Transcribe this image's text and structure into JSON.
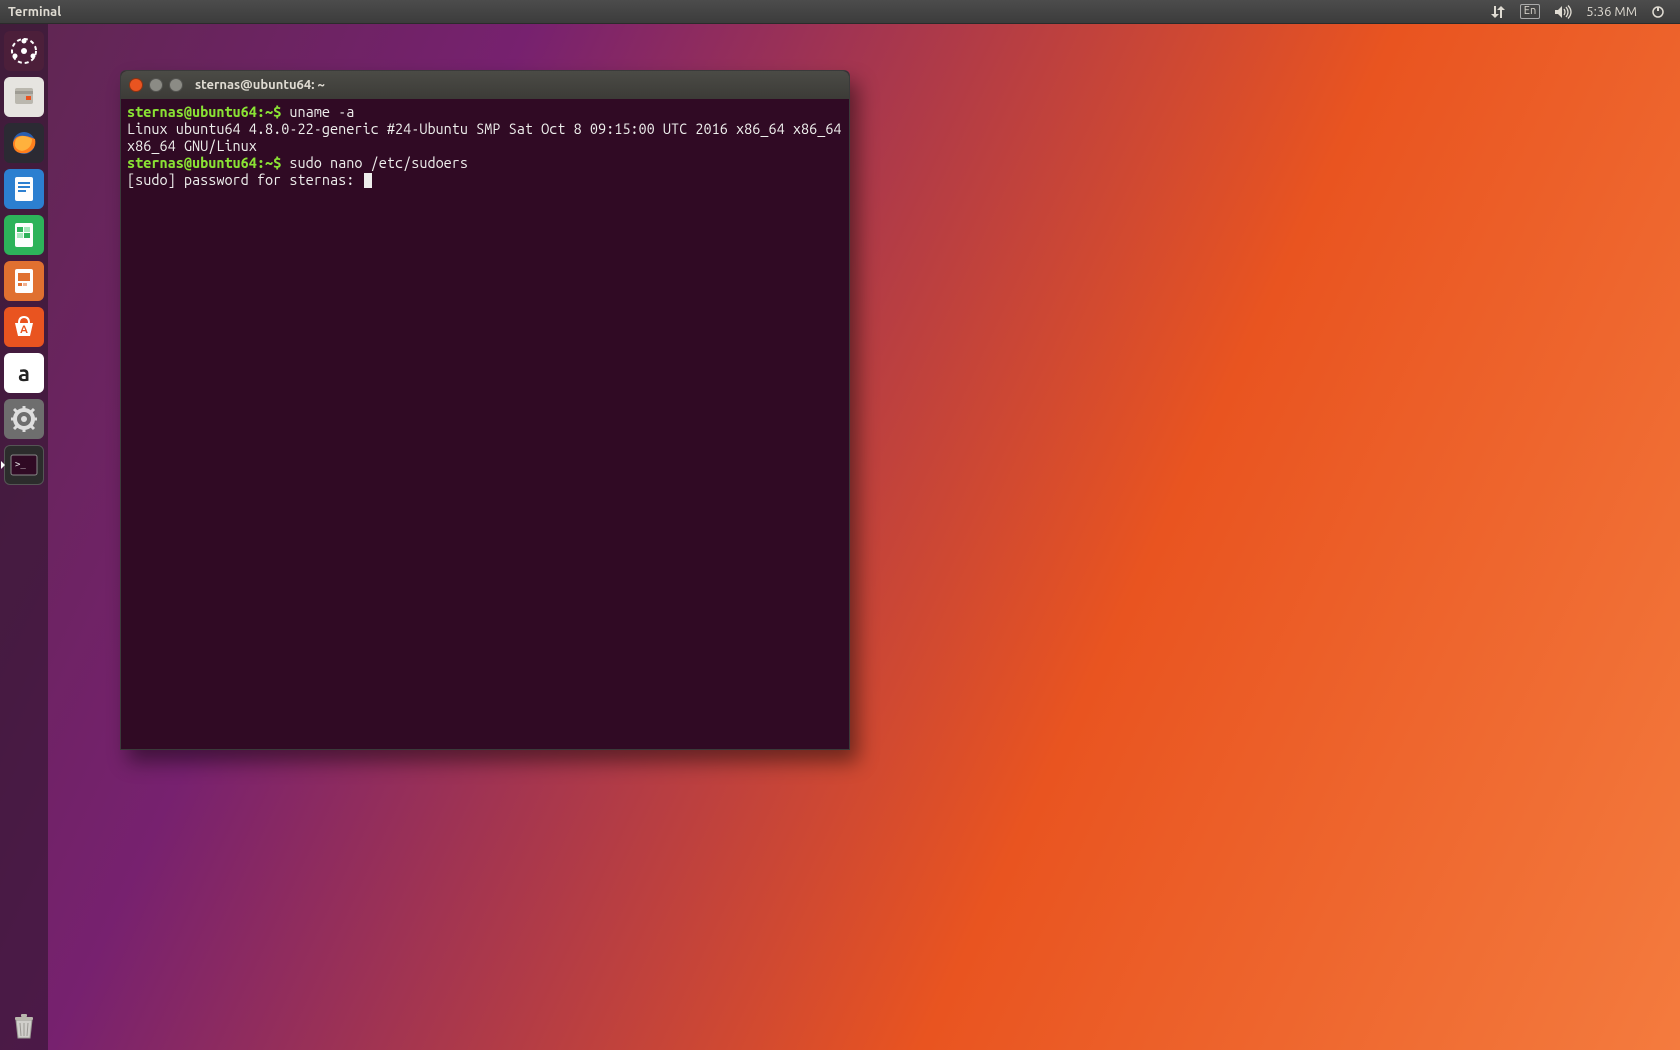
{
  "topbar": {
    "app_name": "Terminal",
    "lang": "En",
    "time": "5:36 MM"
  },
  "launcher": {
    "items": [
      {
        "name": "dash",
        "label": "Dash"
      },
      {
        "name": "files",
        "label": "Files"
      },
      {
        "name": "firefox",
        "label": "Firefox"
      },
      {
        "name": "writer",
        "label": "LibreOffice Writer"
      },
      {
        "name": "calc",
        "label": "LibreOffice Calc"
      },
      {
        "name": "impress",
        "label": "LibreOffice Impress"
      },
      {
        "name": "software",
        "label": "Ubuntu Software"
      },
      {
        "name": "amazon",
        "label": "Amazon"
      },
      {
        "name": "settings",
        "label": "System Settings"
      },
      {
        "name": "terminal",
        "label": "Terminal",
        "running": true
      }
    ],
    "trash": {
      "label": "Trash"
    }
  },
  "terminal": {
    "title": "sternas@ubuntu64: ~",
    "lines": [
      {
        "prompt": "sternas@ubuntu64:~$ ",
        "cmd": "uname -a"
      },
      {
        "out": "Linux ubuntu64 4.8.0-22-generic #24-Ubuntu SMP Sat Oct 8 09:15:00 UTC 2016 x86_64 x86_64 x86_64 GNU/Linux"
      },
      {
        "prompt": "sternas@ubuntu64:~$ ",
        "cmd": "sudo nano /etc/sudoers"
      },
      {
        "out": "[sudo] password for sternas: ",
        "cursor": true
      }
    ]
  }
}
